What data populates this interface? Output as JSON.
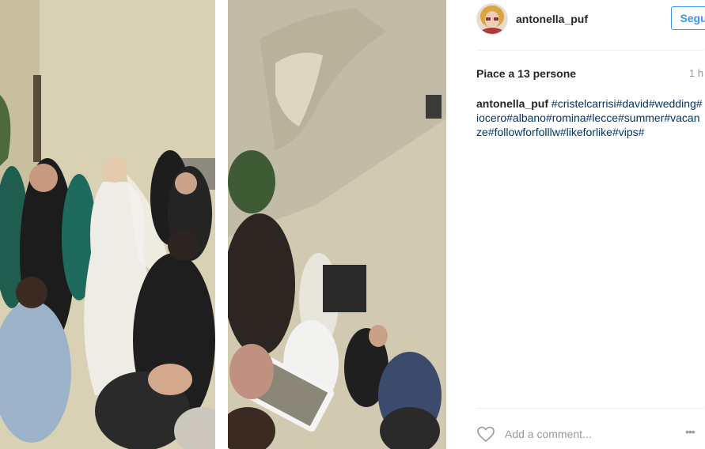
{
  "post": {
    "username": "antonella_puf",
    "follow_label": "Segui",
    "likes_text": "Piace a 13 persone",
    "time_ago": "1 h",
    "caption_user": "antonella_puf",
    "caption_tags": "#cristelcarrisi#david#wedding#iocero#albano#romina#lecce#summer#vacanze#followforfolllw#likeforlike#vips#"
  },
  "comment_box": {
    "placeholder": "Add a comment...",
    "more_icon": "•••"
  },
  "icons": {
    "like": "heart-outline-icon",
    "more": "ellipsis-icon"
  },
  "colors": {
    "accent": "#3897f0",
    "hashtag": "#003569",
    "muted": "#999999",
    "text": "#262626"
  }
}
